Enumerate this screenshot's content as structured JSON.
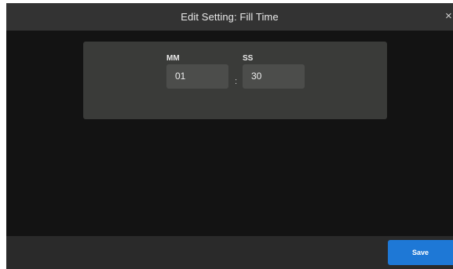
{
  "dialog": {
    "title": "Edit Setting: Fill Time",
    "close_icon": "×"
  },
  "time": {
    "minutes_label": "MM",
    "minutes_value": "01",
    "separator": ":",
    "seconds_label": "SS",
    "seconds_value": "30"
  },
  "footer": {
    "save_label": "Save"
  },
  "colors": {
    "background": "#131313",
    "title_bar": "#333333",
    "panel": "#3a3b39",
    "input": "#4c4d4b",
    "accent": "#1e78d6"
  }
}
